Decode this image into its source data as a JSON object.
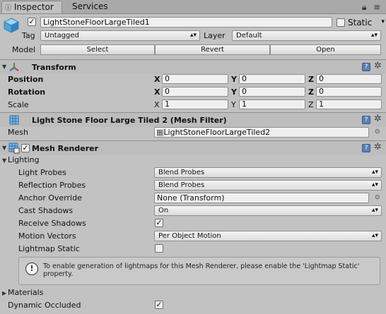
{
  "tabs": {
    "inspector": "Inspector",
    "services": "Services"
  },
  "header": {
    "object_name": "LightStoneFloorLargeTiled1",
    "active": true,
    "static_label": "Static",
    "static_checked": false,
    "tag_label": "Tag",
    "tag_value": "Untagged",
    "layer_label": "Layer",
    "layer_value": "Default",
    "model_label": "Model",
    "model_buttons": [
      "Select",
      "Revert",
      "Open"
    ]
  },
  "transform": {
    "title": "Transform",
    "rows": [
      {
        "label": "Position",
        "bold": true,
        "x": "0",
        "y": "0",
        "z": "0"
      },
      {
        "label": "Rotation",
        "bold": true,
        "x": "0",
        "y": "0",
        "z": "0"
      },
      {
        "label": "Scale",
        "bold": false,
        "x": "1",
        "y": "1",
        "z": "1"
      }
    ],
    "axis": {
      "x": "X",
      "y": "Y",
      "z": "Z"
    }
  },
  "mesh_filter": {
    "title": "Light Stone Floor Large Tiled 2 (Mesh Filter)",
    "mesh_label": "Mesh",
    "mesh_value": "LightStoneFloorLargeTiled2"
  },
  "mesh_renderer": {
    "title": "Mesh Renderer",
    "enabled": true,
    "lighting_label": "Lighting",
    "light_probes_label": "Light Probes",
    "light_probes_value": "Blend Probes",
    "reflection_probes_label": "Reflection Probes",
    "reflection_probes_value": "Blend Probes",
    "anchor_override_label": "Anchor Override",
    "anchor_override_value": "None (Transform)",
    "cast_shadows_label": "Cast Shadows",
    "cast_shadows_value": "On",
    "receive_shadows_label": "Receive Shadows",
    "receive_shadows_checked": true,
    "motion_vectors_label": "Motion Vectors",
    "motion_vectors_value": "Per Object Motion",
    "lightmap_static_label": "Lightmap Static",
    "lightmap_static_checked": false,
    "info_message": "To enable generation of lightmaps for this Mesh Renderer, please enable the 'Lightmap Static' property.",
    "materials_label": "Materials",
    "dynamic_occluded_label": "Dynamic Occluded",
    "dynamic_occluded_checked": true
  },
  "icons": {
    "lock": "lock-icon",
    "menu": "menu-icon",
    "gear": "gear-icon",
    "help": "help-icon",
    "cube": "gameobject-cube-icon",
    "transform": "transform-axes-icon",
    "mesh_filter": "mesh-filter-grid-icon",
    "mesh_renderer": "mesh-renderer-icon",
    "info": "info-icon"
  },
  "check_mark": "✓",
  "help_mark": "?",
  "info_mark": "!"
}
